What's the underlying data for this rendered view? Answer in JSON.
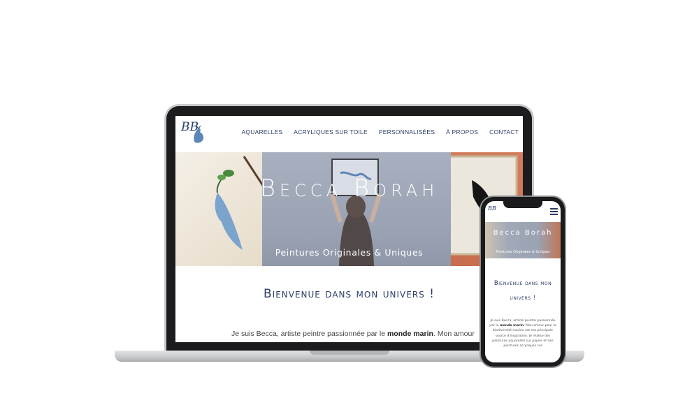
{
  "laptop": {
    "logo_text": "BB",
    "nav": [
      {
        "label": "AQUARELLES"
      },
      {
        "label": "ACRYLIQUES SUR TOILE"
      },
      {
        "label": "PERSONNALISÉES"
      },
      {
        "label": "À PROPOS"
      },
      {
        "label": "CONTACT"
      }
    ],
    "hero": {
      "title": "Becca Borah",
      "subtitle": "Peintures Originales & Uniques"
    },
    "welcome": "Bienvenue dans mon univers !",
    "intro": {
      "before": "Je suis Becca, artiste peintre passionnée par le ",
      "bold": "monde marin",
      "after": ". Mon amour"
    }
  },
  "phone": {
    "logo_text": "BB",
    "hero": {
      "title": "Becca Borah",
      "subtitle": "Peintures Originales & Uniques"
    },
    "welcome": "Bienvenue dans mon univers !",
    "text_before": "Je suis Becca, artiste peintre passionnée par le ",
    "text_bold": "monde marin",
    "text_after": ". Mon amour pour la biodiversité marine est ma principale source d'inspiration. Je réalise des peintures aquarelles sur papier et des peintures acryliques sur"
  },
  "colors": {
    "nav_text": "#2b3e66",
    "accent_blue": "#2a3f66",
    "hero_right": "#c86e4d"
  }
}
